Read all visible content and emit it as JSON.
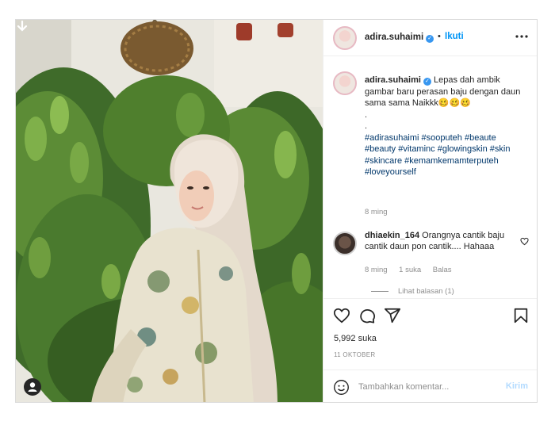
{
  "post": {
    "username": "adira.suhaimi",
    "follow_separator": "•",
    "follow_label": "Ikuti",
    "caption": {
      "username": "adira.suhaimi",
      "text": "Lepas dah ambik gambar baru perasan baju dengan daun sama sama Naikkk🥴🥴🥴",
      "dot1": ".",
      "dot2": ".",
      "hashtags": "#adirasuhaimi #sooputeh #beaute #beauty #vitaminc #glowingskin #skin #skincare #kemamkemamterputeh #loveyourself",
      "time": "8 ming"
    },
    "comment": {
      "username": "dhiaekin_164",
      "text": "Orangnya cantik baju cantik daun pon cantik.... Hahaaa",
      "time": "8 ming",
      "likes": "1 suka",
      "reply_label": "Balas",
      "view_replies": "Lihat balasan (1)"
    },
    "likes_count": "5,992 suka",
    "date": "11 OKTOBER",
    "add_comment_placeholder": "Tambahkan komentar...",
    "post_button": "Kirim",
    "icons": [
      "download-icon",
      "user-tag-icon",
      "more-icon",
      "heart-icon",
      "comment-icon",
      "share-icon",
      "bookmark-icon",
      "emoji-icon",
      "verified-icon"
    ],
    "colors": {
      "accent": "#0095f6",
      "muted": "#8e8e8e",
      "post_disabled": "#b3dbff",
      "hashtag": "#00376b"
    }
  }
}
